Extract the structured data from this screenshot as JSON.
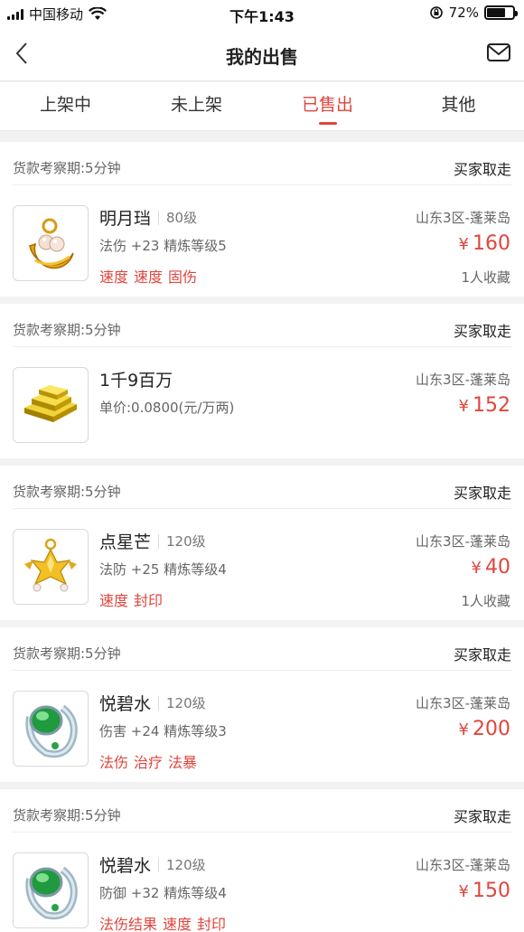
{
  "status_bar": {
    "carrier": "中国移动",
    "time": "下午1:43",
    "battery": "72%",
    "battery_level": 0.72
  },
  "nav": {
    "title": "我的出售"
  },
  "tabs": [
    {
      "label": "上架中",
      "active": false
    },
    {
      "label": "未上架",
      "active": false
    },
    {
      "label": "已售出",
      "active": true
    },
    {
      "label": "其他",
      "active": false
    }
  ],
  "items": [
    {
      "period": "货款考察期:5分钟",
      "status": "买家取走",
      "name": "明月珰",
      "level": "80级",
      "server": "山东3区-蓬莱岛",
      "attr": "法伤 +23 精炼等级5",
      "price": "160",
      "currency": "¥",
      "tags": [
        "速度",
        "速度",
        "固伤"
      ],
      "favorites": "1人收藏",
      "icon": "earring-icon"
    },
    {
      "period": "货款考察期:5分钟",
      "status": "买家取走",
      "name": "1千9百万",
      "level": "",
      "server": "山东3区-蓬莱岛",
      "attr": "单价:0.0800(元/万两)",
      "price": "152",
      "currency": "¥",
      "tags": [],
      "favorites": "",
      "icon": "gold-bar-icon"
    },
    {
      "period": "货款考察期:5分钟",
      "status": "买家取走",
      "name": "点星芒",
      "level": "120级",
      "server": "山东3区-蓬莱岛",
      "attr": "法防 +25 精炼等级4",
      "price": "40",
      "currency": "¥",
      "tags": [
        "速度",
        "封印"
      ],
      "favorites": "1人收藏",
      "icon": "star-earring-icon"
    },
    {
      "period": "货款考察期:5分钟",
      "status": "买家取走",
      "name": "悦碧水",
      "level": "120级",
      "server": "山东3区-蓬莱岛",
      "attr": "伤害 +24 精炼等级3",
      "price": "200",
      "currency": "¥",
      "tags": [
        "法伤",
        "治疗",
        "法暴"
      ],
      "favorites": "",
      "icon": "jade-ring-icon"
    },
    {
      "period": "货款考察期:5分钟",
      "status": "买家取走",
      "name": "悦碧水",
      "level": "120级",
      "server": "山东3区-蓬莱岛",
      "attr": "防御 +32 精炼等级4",
      "price": "150",
      "currency": "¥",
      "tags": [
        "法伤结果",
        "速度",
        "封印"
      ],
      "favorites": "",
      "icon": "jade-ring-icon"
    }
  ],
  "colors": {
    "accent": "#e0453d",
    "background": "#f2f2f2"
  }
}
